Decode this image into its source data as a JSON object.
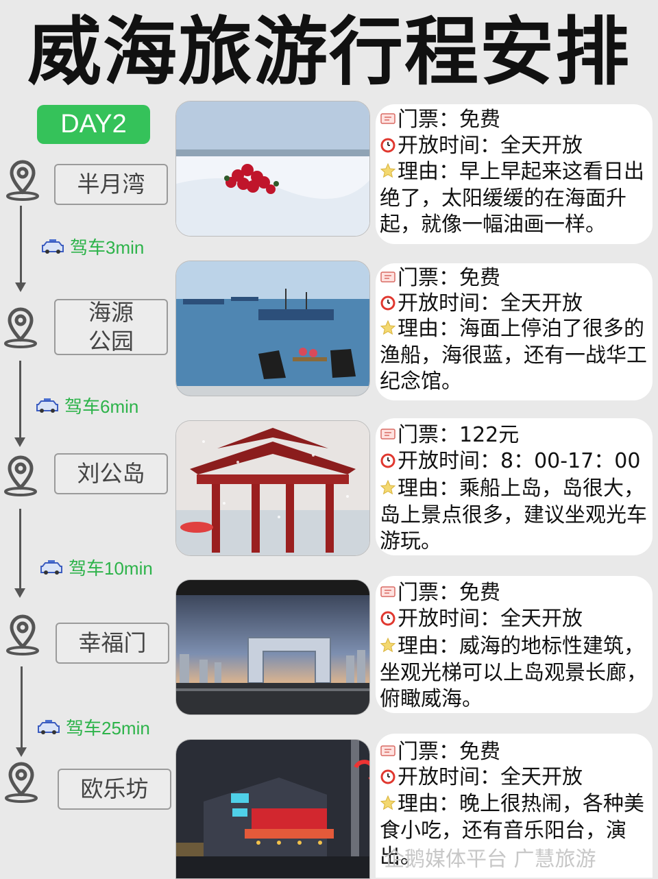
{
  "title": "威海旅游行程安排",
  "day_label": "DAY2",
  "stops": [
    {
      "name": "半月湾",
      "ticket": "门票：免费",
      "hours": "开放时间：全天开放",
      "reason": "理由：早上早起来这看日出绝了，太阳缓缓的在海面升起，就像一幅油画一样。"
    },
    {
      "name": "海源公园",
      "ticket": "门票：免费",
      "hours": "开放时间：全天开放",
      "reason": "理由：海面上停泊了很多的渔船，海很蓝，还有一战华工纪念馆。"
    },
    {
      "name": "刘公岛",
      "ticket": "门票：122元",
      "hours": "开放时间：8：00-17：00",
      "reason": "理由：乘船上岛，岛很大，岛上景点很多，建议坐观光车游玩。"
    },
    {
      "name": "幸福门",
      "ticket": "门票：免费",
      "hours": "开放时间：全天开放",
      "reason": "理由：威海的地标性建筑，坐观光梯可以上岛观景长廊，俯瞰威海。"
    },
    {
      "name": "欧乐坊",
      "ticket": "门票：免费",
      "hours": "开放时间：全天开放",
      "reason": "理由：晚上很热闹，各种美食小吃，还有音乐阳台，演出。"
    }
  ],
  "drives": [
    "驾车3min",
    "驾车6min",
    "驾车10min",
    "驾车25min"
  ],
  "watermark": "企鹅媒体平台 广慧旅游",
  "icons": {
    "pin": "location-pin-icon",
    "car": "taxi-car-icon",
    "ticket": "ticket-icon",
    "clock": "alarm-clock-icon",
    "star": "star-icon"
  },
  "colors": {
    "accent_green": "#35c25a",
    "drive_text": "#2db34a",
    "background": "#e9e9e9"
  }
}
